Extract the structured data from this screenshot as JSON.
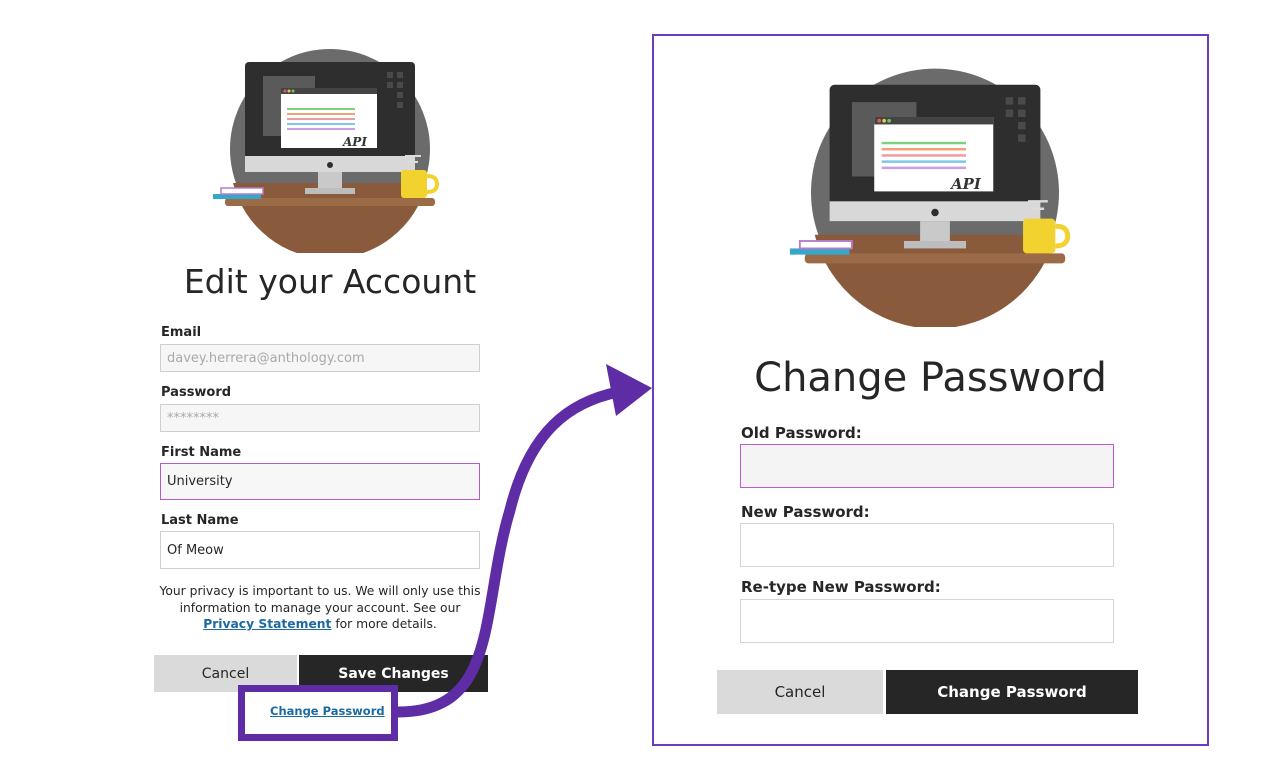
{
  "colors": {
    "accent_purple": "#5e2ca5",
    "link_blue": "#1b6aa0",
    "dark_button": "#262626",
    "light_button": "#dadada",
    "focus_border": "#b35bd1"
  },
  "edit_account": {
    "illustration_label": "API",
    "title": "Edit your Account",
    "email": {
      "label": "Email",
      "value": "davey.herrera@anthology.com"
    },
    "password": {
      "label": "Password",
      "value": "********"
    },
    "first_name": {
      "label": "First Name",
      "value": "University"
    },
    "last_name": {
      "label": "Last Name",
      "value": "Of Meow"
    },
    "privacy": {
      "text_before": "Your privacy is important to us. We will only use this information to manage your account. See our ",
      "link_text": "Privacy Statement",
      "text_after": " for more details."
    },
    "cancel_label": "Cancel",
    "save_label": "Save Changes",
    "change_password_link": "Change Password"
  },
  "change_password": {
    "illustration_label": "API",
    "title": "Change Password",
    "old_password_label": "Old Password:",
    "new_password_label": "New Password:",
    "retype_password_label": "Re-type New Password:",
    "cancel_label": "Cancel",
    "submit_label": "Change Password"
  }
}
